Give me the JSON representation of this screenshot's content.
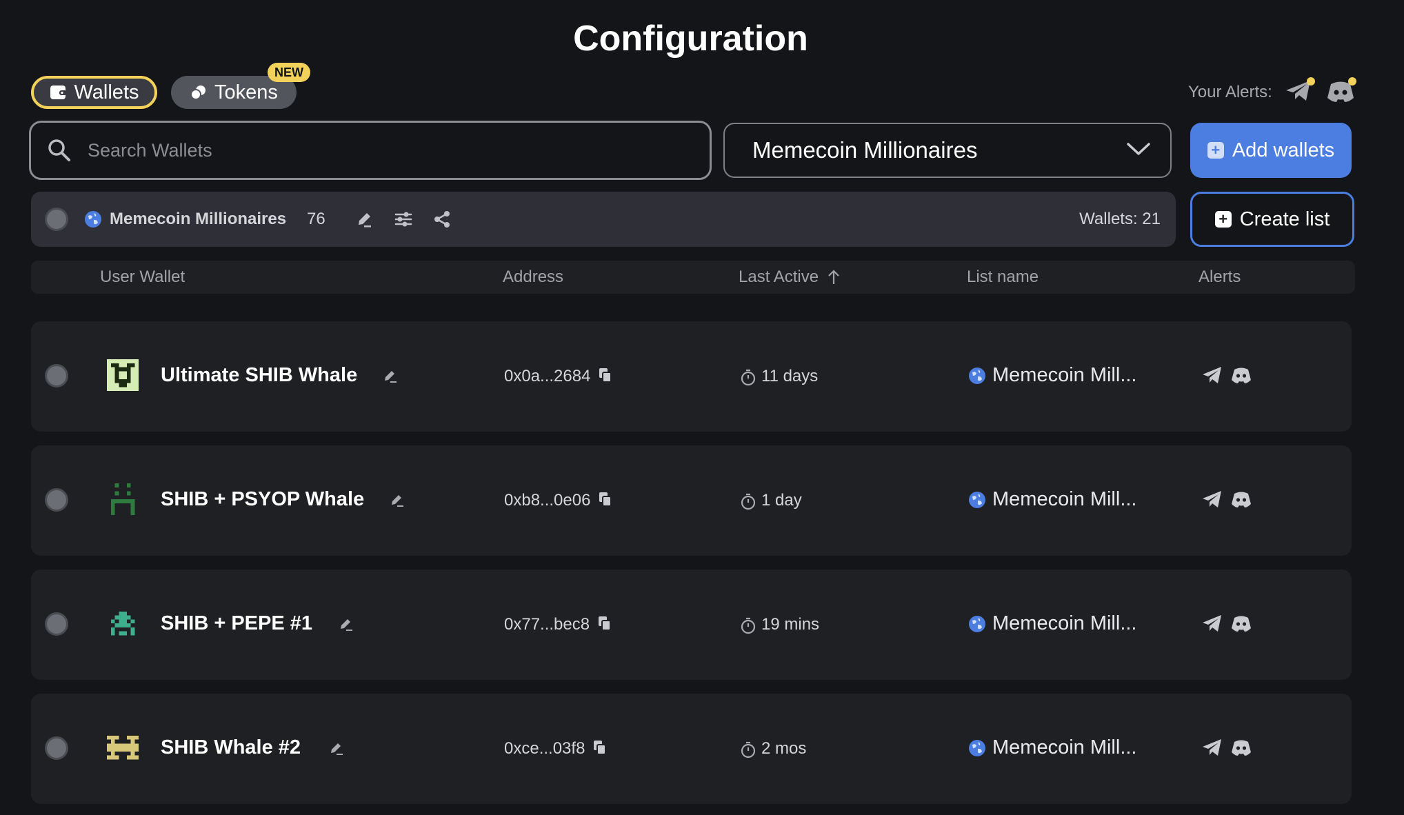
{
  "page": {
    "title": "Configuration"
  },
  "tabs": [
    {
      "label": "Wallets",
      "active": true
    },
    {
      "label": "Tokens",
      "badge": "NEW"
    }
  ],
  "alerts": {
    "label": "Your Alerts:",
    "icons": [
      "telegram-icon",
      "discord-icon"
    ]
  },
  "search": {
    "placeholder": "Search Wallets",
    "value": ""
  },
  "list_select": {
    "value": "Memecoin Millionaires"
  },
  "buttons": {
    "add_wallets": "Add wallets",
    "create_list": "Create list"
  },
  "list_bar": {
    "name": "Memecoin Millionaires",
    "count": "76",
    "wallets": "Wallets: 21"
  },
  "table": {
    "headers": {
      "user_wallet": "User Wallet",
      "address": "Address",
      "last_active": "Last Active",
      "list_name": "List name",
      "alerts": "Alerts"
    },
    "rows": [
      {
        "name": "Ultimate SHIB Whale",
        "address": "0x0a...2684",
        "last_active": "11 days",
        "list_name": "Memecoin Mill..."
      },
      {
        "name": "SHIB + PSYOP Whale",
        "address": "0xb8...0e06",
        "last_active": "1 day",
        "list_name": "Memecoin Mill..."
      },
      {
        "name": "SHIB + PEPE #1",
        "address": "0x77...bec8",
        "last_active": "19 mins",
        "list_name": "Memecoin Mill..."
      },
      {
        "name": "SHIB Whale #2",
        "address": "0xce...03f8",
        "last_active": "2 mos",
        "list_name": "Memecoin Mill..."
      }
    ]
  },
  "colors": {
    "accent": "#4c7de1",
    "highlight": "#f3d25b",
    "background": "#141518",
    "row": "#1f2024"
  }
}
